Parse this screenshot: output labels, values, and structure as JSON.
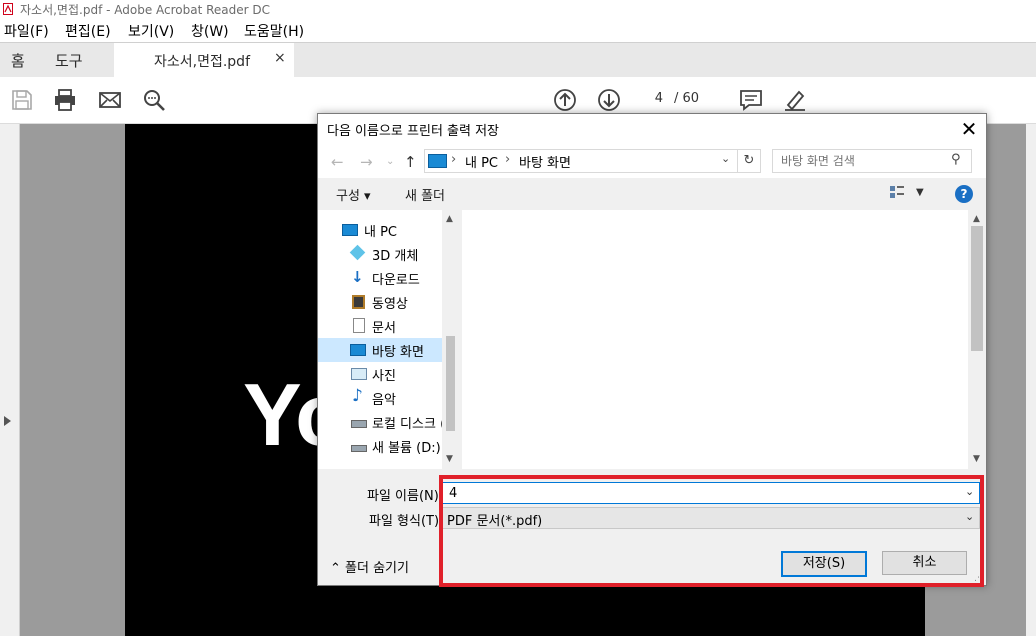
{
  "window": {
    "title": "자소서,면접.pdf - Adobe Acrobat Reader DC",
    "accent_color": "#e0202a"
  },
  "menu": [
    "파일(F)",
    "편집(E)",
    "보기(V)",
    "창(W)",
    "도움말(H)"
  ],
  "tabs": {
    "home": "홈",
    "tools": "도구",
    "document": "자소서,면접.pdf",
    "close_glyph": "×"
  },
  "toolbar": {
    "icons": [
      "save-icon",
      "print-icon",
      "email-icon",
      "zoom-search-icon",
      "page-up-icon",
      "page-down-icon",
      "comment-icon",
      "sign-icon"
    ],
    "page_current": "4",
    "page_total": "/ 60"
  },
  "document": {
    "visible_text": "Yo"
  },
  "dialog": {
    "title": "다음 이름으로 프린터 출력 저장",
    "close_glyph": "✕",
    "address": {
      "crumbs": [
        "내 PC",
        "바탕 화면"
      ],
      "separator": "›"
    },
    "search_placeholder": "바탕 화면 검색",
    "commands": {
      "organize": "구성 ▾",
      "new_folder": "새 폴더",
      "help": "?"
    },
    "nav_items": [
      {
        "label": "내 PC",
        "icon": "pc-icon"
      },
      {
        "label": "3D 개체",
        "icon": "3d-objects-icon"
      },
      {
        "label": "다운로드",
        "icon": "download-icon"
      },
      {
        "label": "동영상",
        "icon": "video-icon"
      },
      {
        "label": "문서",
        "icon": "document-icon"
      },
      {
        "label": "바탕 화면",
        "icon": "desktop-icon",
        "selected": true
      },
      {
        "label": "사진",
        "icon": "pictures-icon"
      },
      {
        "label": "음악",
        "icon": "music-icon"
      },
      {
        "label": "로컬 디스크 (",
        "icon": "local-disk-icon"
      },
      {
        "label": "새 볼륨 (D:)",
        "icon": "drive-icon"
      }
    ],
    "file_name_label": "파일 이름(N):",
    "file_name_value": "4",
    "file_type_label": "파일 형식(T):",
    "file_type_value": "PDF 문서(*.pdf)",
    "hide_folders": "⌃ 폴더 숨기기",
    "save_button": "저장(S)",
    "cancel_button": "취소"
  }
}
